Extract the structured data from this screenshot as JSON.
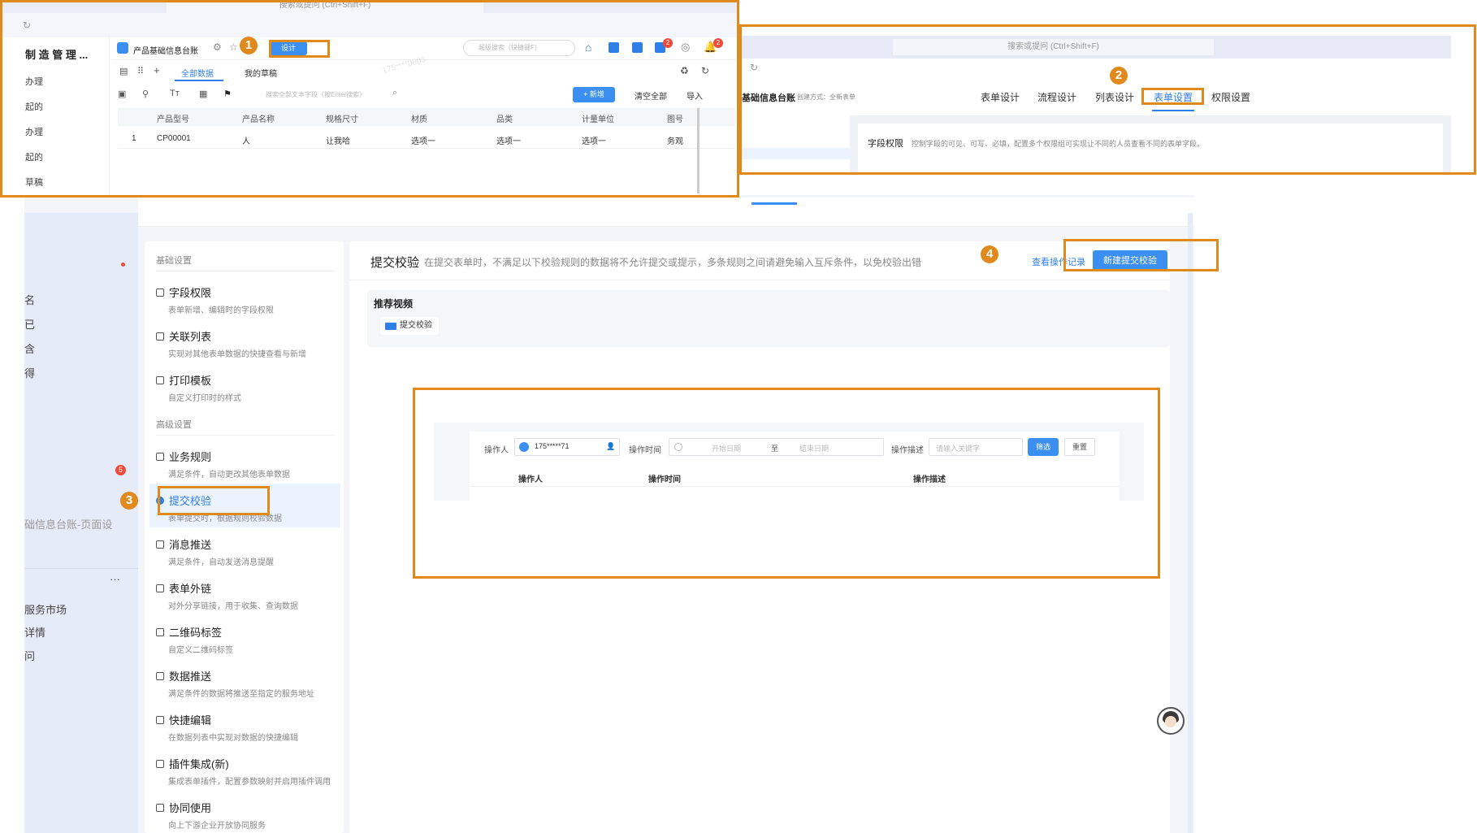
{
  "screenshot1": {
    "address_placeholder": "搜索或提问 (Ctrl+Shift+F)",
    "app_title": "制 造 管 理 ...",
    "form_name": "产品基础信息台账",
    "design_button": "设计",
    "search_placeholder": "超级搜索（快捷键F）",
    "notification_badges": [
      "2",
      "2"
    ],
    "tabs": [
      "全部数据",
      "我的草稿"
    ],
    "field_search_placeholder": "搜索全部文本字段（按Enter搜索）",
    "add_button": "+ 新增",
    "clear_all": "清空全部",
    "import_label": "导入",
    "sidebar_items": [
      "办理",
      "起的",
      "办理",
      "起的",
      "草稿"
    ],
    "columns": [
      "产品型号",
      "产品名称",
      "规格尺寸",
      "材质",
      "品类",
      "计量单位",
      "图号"
    ],
    "row": {
      "index": "1",
      "cells": [
        "CP00001",
        "人",
        "让我哈",
        "选项一",
        "选项一",
        "选项一",
        "务观"
      ]
    },
    "watermark": "175****0803"
  },
  "screenshot2": {
    "address_placeholder": "搜索或提问 (Ctrl+Shift+F)",
    "form_name": "基础信息台账",
    "create_mode": "创建方式：全新表单",
    "tabs": [
      "表单设计",
      "流程设计",
      "列表设计",
      "表单设置",
      "权限设置"
    ],
    "active_tab": "表单设置",
    "field_permission_title": "字段权限",
    "field_permission_desc": "控制字段的可见、可写、必填，配置多个权限组可实现让不同的人员查看不同的表单字段。"
  },
  "left_strip": {
    "items": [
      "名",
      "已",
      "含",
      "得"
    ],
    "page_name": "础信息台账-页面设",
    "more": "···",
    "bottom_items": [
      "服务市场",
      "详情",
      "问"
    ],
    "badge": "5"
  },
  "settings": {
    "basic_section": "基础设置",
    "advanced_section": "高级设置",
    "basic_items": [
      {
        "title": "字段权限",
        "desc": "表单新增、编辑时的字段权限"
      },
      {
        "title": "关联列表",
        "desc": "实现对其他表单数据的快捷查看与新增"
      },
      {
        "title": "打印模板",
        "desc": "自定义打印时的样式"
      }
    ],
    "advanced_items": [
      {
        "title": "业务规则",
        "desc": "满足条件，自动更改其他表单数据"
      },
      {
        "title": "提交校验",
        "desc": "表单提交时，根据规则校验数据"
      },
      {
        "title": "消息推送",
        "desc": "满足条件，自动发送消息提醒"
      },
      {
        "title": "表单外链",
        "desc": "对外分享链接，用于收集、查询数据"
      },
      {
        "title": "二维码标签",
        "desc": "自定义二维码标签"
      },
      {
        "title": "数据推送",
        "desc": "满足条件的数据将推送至指定的服务地址"
      },
      {
        "title": "快捷编辑",
        "desc": "在数据列表中实现对数据的快捷编辑"
      },
      {
        "title": "插件集成(新)",
        "desc": "集成表单插件，配置参数映射并启用插件调用"
      },
      {
        "title": "协同使用",
        "desc": "向上下游企业开放协同服务"
      }
    ]
  },
  "content": {
    "title": "提交校验",
    "desc": "在提交表单时，不满足以下校验规则的数据将不允许提交或提示，多条规则之间请避免输入互斥条件，以免校验出错",
    "view_log": "查看操作记录",
    "new_button": "新建提交校验",
    "video_section": "推荐视频",
    "video_item": "提交校验"
  },
  "log_panel": {
    "operator_label": "操作人",
    "operator_value": "175*****71",
    "time_label": "操作时间",
    "start_placeholder": "开始日期",
    "to_label": "至",
    "end_placeholder": "结束日期",
    "desc_label": "操作描述",
    "desc_placeholder": "请输入关键字",
    "filter_button": "筛选",
    "reset_button": "重置",
    "columns": [
      "操作人",
      "操作时间",
      "操作描述"
    ]
  },
  "steps": [
    "1",
    "2",
    "3",
    "4"
  ],
  "colors": {
    "annotation": "#e08a1e",
    "primary": "#3b8ff0",
    "badge_red": "#f04b3a"
  }
}
